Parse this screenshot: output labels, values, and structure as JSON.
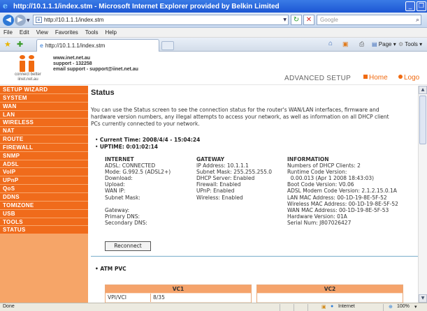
{
  "window": {
    "title": "http://10.1.1.1/index.stm - Microsoft Internet Explorer provided by Belkin Limited",
    "minimize_glyph": "_",
    "restore_glyph": "❐"
  },
  "address_bar": {
    "url": "http://10.1.1.1/index.stm",
    "search_placeholder": "Google"
  },
  "menu": [
    "File",
    "Edit",
    "View",
    "Favorites",
    "Tools",
    "Help"
  ],
  "tab": {
    "label": "http://10.1.1.1/index.stm"
  },
  "commands": {
    "page": "Page",
    "tools": "Tools"
  },
  "header": {
    "contact_line1": "www.inet.net.au",
    "contact_line2": "support - 132258",
    "contact_line3": "email support - support@iinet.net.au",
    "brand_tag_line1": "connect better",
    "brand_tag_line2": "iinet.net.au",
    "advanced_setup": "ADVANCED SETUP",
    "home_link": "Home",
    "logout_link": "Logo"
  },
  "sidebar": {
    "items": [
      "SETUP WIZARD",
      "SYSTEM",
      "WAN",
      "LAN",
      "WIRELESS",
      "NAT",
      "ROUTE",
      "FIREWALL",
      "SNMP",
      "ADSL",
      "VoIP",
      "UPnP",
      "QoS",
      "DDNS",
      "TOMIZONE",
      "USB",
      "TOOLS",
      "STATUS"
    ]
  },
  "main": {
    "title": "Status",
    "intro_line1": "You can use the Status screen to see the connection status for the router's WAN/LAN interfaces, firmware and",
    "intro_line2": "hardware version numbers, any illegal attempts to access your network, as well as information on all DHCP client",
    "intro_line3": "PCs currently connected to your network.",
    "current_time": "Current Time: 2008/4/4 - 15:04:24",
    "uptime": "UPTIME: 0:01:02:14",
    "internet": {
      "header": "INTERNET",
      "lines": [
        "ADSL: CONNECTED",
        "Mode: G.992.5 (ADSL2+)",
        "Download:",
        "Upload:",
        "WAN IP:",
        "Subnet Mask:",
        "",
        "Gateway:",
        "Primary DNS:",
        "Secondary DNS:"
      ]
    },
    "gateway": {
      "header": "GATEWAY",
      "lines": [
        "IP Address: 10.1.1.1",
        "Subnet Mask: 255.255.255.0",
        "DHCP Server: Enabled",
        "Firewall: Enabled",
        "UPnP: Enabled",
        "Wireless: Enabled"
      ]
    },
    "information": {
      "header": "INFORMATION",
      "lines": [
        "Numbers of DHCP Clients: 2",
        "Runtime Code Version:",
        "  0.00.013 (Apr 1 2008 18:43:03)",
        "Boot Code Version: V0.06",
        "ADSL Modem Code Version: 2.1.2.15.0.1A",
        "LAN MAC Address: 00-1D-19-8E-5F-52",
        "Wireless MAC Address: 00-1D-19-8E-5F-52",
        "WAN MAC Address: 00-1D-19-8E-5F-53",
        "Hardware Version: 01A",
        "Serial Num: J807026427"
      ]
    },
    "reconnect_label": "Reconnect",
    "atm_heading": "ATM PVC",
    "vc1": {
      "header": "VC1",
      "row_label": "VPI/VCI",
      "row_value": "8/35"
    },
    "vc2": {
      "header": "VC2"
    }
  },
  "statusbar": {
    "left": "Done",
    "zone": "Internet",
    "zoom": "100%"
  },
  "colors": {
    "accent_orange": "#f06b1b",
    "sidebar_bg": "#f6a568",
    "titlebar_blue": "#1c56d4"
  }
}
